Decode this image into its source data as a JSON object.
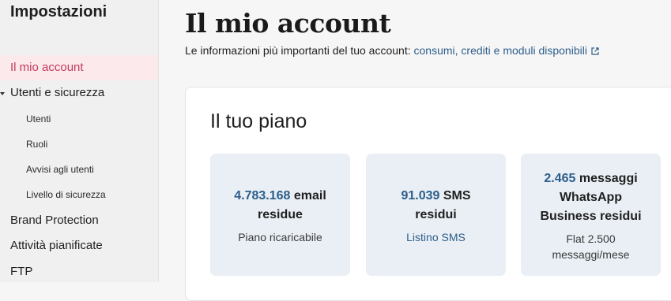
{
  "sidebar": {
    "title": "Impostazioni",
    "items": [
      {
        "label": "Il mio account"
      },
      {
        "label": "Utenti e sicurezza"
      },
      {
        "label": "Utenti"
      },
      {
        "label": "Ruoli"
      },
      {
        "label": "Avvisi agli utenti"
      },
      {
        "label": "Livello di sicurezza"
      },
      {
        "label": "Brand Protection"
      },
      {
        "label": "Attività pianificate"
      },
      {
        "label": "FTP"
      }
    ]
  },
  "main": {
    "title": "Il mio account",
    "subtitle_text": "Le informazioni più importanti del tuo account:",
    "subtitle_link": "consumi, crediti e moduli disponibili",
    "link_icon": "external-link-icon"
  },
  "plan": {
    "title": "Il tuo piano",
    "tiles": [
      {
        "number": "4.783.168",
        "label_a": "email",
        "label_b": "residue",
        "sub": "Piano ricaricabile"
      },
      {
        "number": "91.039",
        "label_a": "SMS",
        "label_b": "residui",
        "sub": "Listino SMS"
      },
      {
        "number": "2.465",
        "label_a": "messaggi",
        "label_b": "WhatsApp",
        "label_c": "Business residui",
        "sub": "Flat 2.500",
        "sub2": "messaggi/mese"
      }
    ]
  },
  "colors": {
    "accent": "#c43a5c",
    "link": "#2c5d8a",
    "tile_bg": "#e9eff5"
  }
}
